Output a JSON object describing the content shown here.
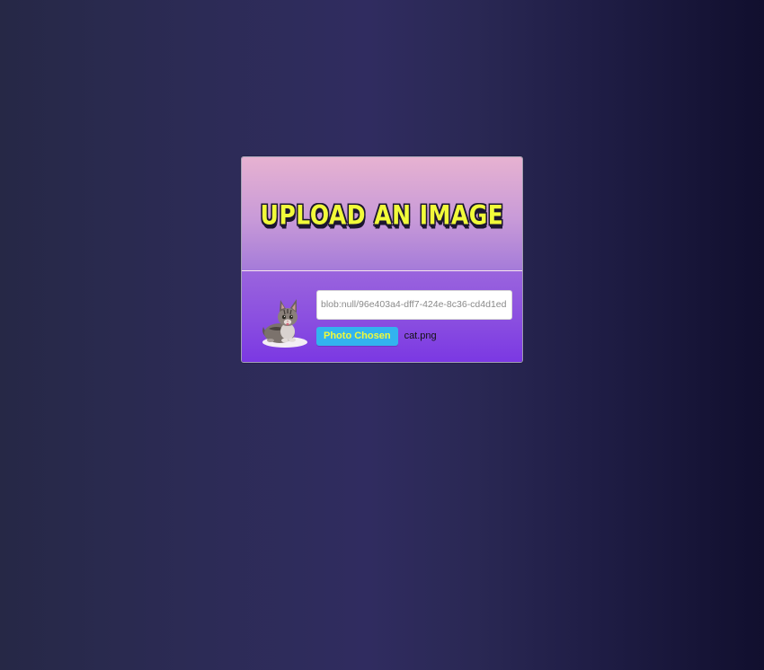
{
  "upload": {
    "title": "UPLOAD AN IMAGE",
    "url_value": "blob:null/96e403a4-dff7-424e-8c36-cd4d1ed",
    "button_label": "Photo Chosen",
    "file_name": "cat.png",
    "preview_icon": "cat-image-icon"
  },
  "colors": {
    "title_fill": "#f1fb3a",
    "button_bg": "#33b3ef",
    "header_top": "#e7b2d1",
    "body_bottom": "#7b38e3"
  }
}
